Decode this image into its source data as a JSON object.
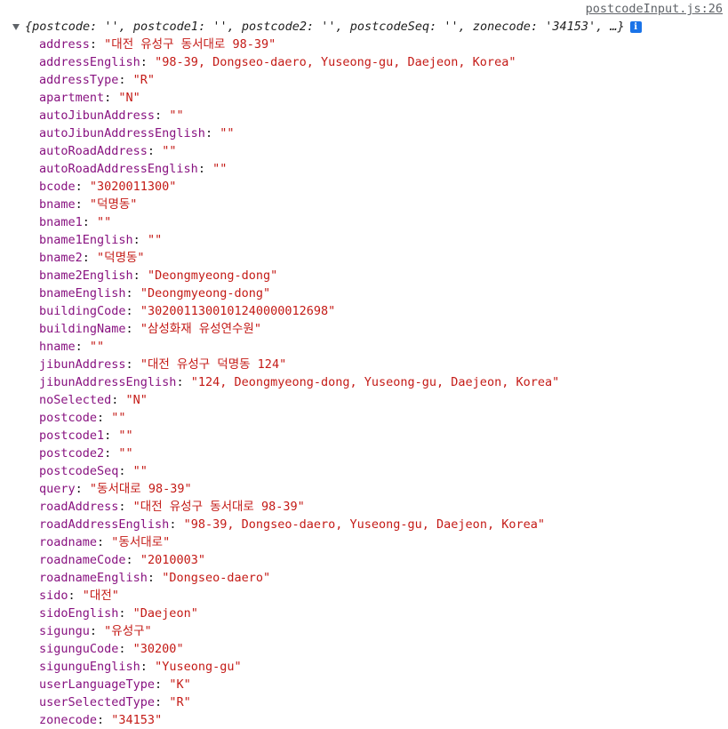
{
  "source_link": "postcodeInput.js:26",
  "summary": "{postcode: '', postcode1: '', postcode2: '', postcodeSeq: '', zonecode: '34153', …}",
  "info_icon": "i",
  "properties": [
    {
      "key": "address",
      "value": "\"대전 유성구 동서대로 98-39\""
    },
    {
      "key": "addressEnglish",
      "value": "\"98-39, Dongseo-daero, Yuseong-gu, Daejeon, Korea\""
    },
    {
      "key": "addressType",
      "value": "\"R\""
    },
    {
      "key": "apartment",
      "value": "\"N\""
    },
    {
      "key": "autoJibunAddress",
      "value": "\"\""
    },
    {
      "key": "autoJibunAddressEnglish",
      "value": "\"\""
    },
    {
      "key": "autoRoadAddress",
      "value": "\"\""
    },
    {
      "key": "autoRoadAddressEnglish",
      "value": "\"\""
    },
    {
      "key": "bcode",
      "value": "\"3020011300\""
    },
    {
      "key": "bname",
      "value": "\"덕명동\""
    },
    {
      "key": "bname1",
      "value": "\"\""
    },
    {
      "key": "bname1English",
      "value": "\"\""
    },
    {
      "key": "bname2",
      "value": "\"덕명동\""
    },
    {
      "key": "bname2English",
      "value": "\"Deongmyeong-dong\""
    },
    {
      "key": "bnameEnglish",
      "value": "\"Deongmyeong-dong\""
    },
    {
      "key": "buildingCode",
      "value": "\"3020011300101240000012698\""
    },
    {
      "key": "buildingName",
      "value": "\"삼성화재 유성연수원\""
    },
    {
      "key": "hname",
      "value": "\"\""
    },
    {
      "key": "jibunAddress",
      "value": "\"대전 유성구 덕명동 124\""
    },
    {
      "key": "jibunAddressEnglish",
      "value": "\"124, Deongmyeong-dong, Yuseong-gu, Daejeon, Korea\""
    },
    {
      "key": "noSelected",
      "value": "\"N\""
    },
    {
      "key": "postcode",
      "value": "\"\""
    },
    {
      "key": "postcode1",
      "value": "\"\""
    },
    {
      "key": "postcode2",
      "value": "\"\""
    },
    {
      "key": "postcodeSeq",
      "value": "\"\""
    },
    {
      "key": "query",
      "value": "\"동서대로 98-39\""
    },
    {
      "key": "roadAddress",
      "value": "\"대전 유성구 동서대로 98-39\""
    },
    {
      "key": "roadAddressEnglish",
      "value": "\"98-39, Dongseo-daero, Yuseong-gu, Daejeon, Korea\""
    },
    {
      "key": "roadname",
      "value": "\"동서대로\""
    },
    {
      "key": "roadnameCode",
      "value": "\"2010003\""
    },
    {
      "key": "roadnameEnglish",
      "value": "\"Dongseo-daero\""
    },
    {
      "key": "sido",
      "value": "\"대전\""
    },
    {
      "key": "sidoEnglish",
      "value": "\"Daejeon\""
    },
    {
      "key": "sigungu",
      "value": "\"유성구\""
    },
    {
      "key": "sigunguCode",
      "value": "\"30200\""
    },
    {
      "key": "sigunguEnglish",
      "value": "\"Yuseong-gu\""
    },
    {
      "key": "userLanguageType",
      "value": "\"K\""
    },
    {
      "key": "userSelectedType",
      "value": "\"R\""
    },
    {
      "key": "zonecode",
      "value": "\"34153\""
    }
  ]
}
